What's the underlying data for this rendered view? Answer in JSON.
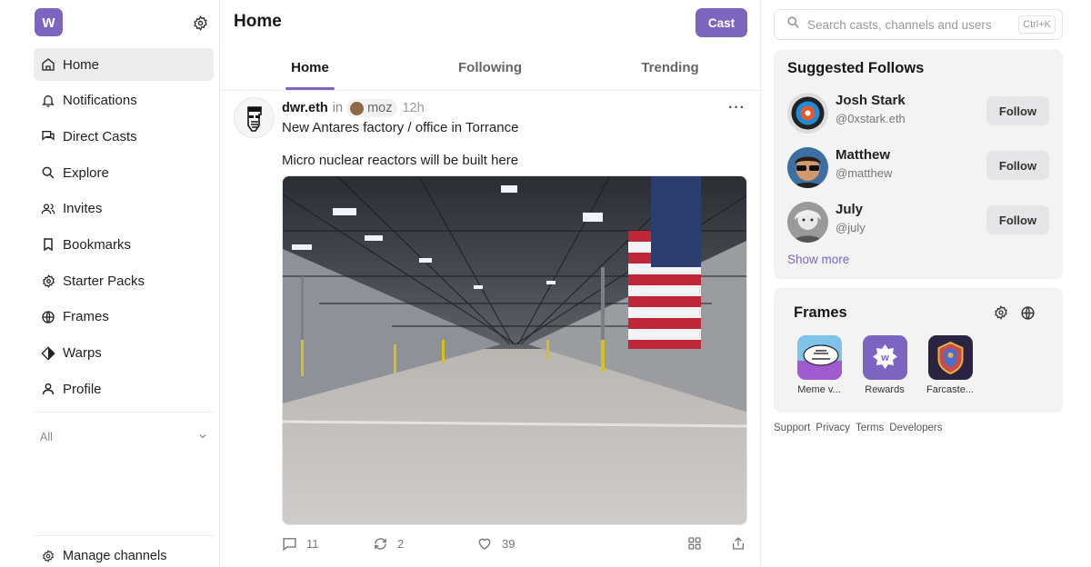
{
  "sidebar": {
    "logo_letter": "w",
    "items": [
      {
        "label": "Home",
        "icon": "home-icon"
      },
      {
        "label": "Notifications",
        "icon": "bell-icon"
      },
      {
        "label": "Direct Casts",
        "icon": "chat-icon"
      },
      {
        "label": "Explore",
        "icon": "search-icon"
      },
      {
        "label": "Invites",
        "icon": "users-icon"
      },
      {
        "label": "Bookmarks",
        "icon": "bookmark-icon"
      },
      {
        "label": "Starter Packs",
        "icon": "package-icon"
      },
      {
        "label": "Frames",
        "icon": "globe-icon"
      },
      {
        "label": "Warps",
        "icon": "diamond-icon"
      },
      {
        "label": "Profile",
        "icon": "person-icon"
      }
    ],
    "filter_label": "All",
    "manage_label": "Manage channels"
  },
  "header": {
    "title": "Home",
    "cast_label": "Cast"
  },
  "tabs": [
    "Home",
    "Following",
    "Trending"
  ],
  "post": {
    "author": "dwr.eth",
    "in_label": "in",
    "channel": "moz",
    "time": "12h",
    "more": "···",
    "line1": "New Antares factory / office in Torrance",
    "line2": "Micro nuclear reactors will be built here",
    "replies": "11",
    "recasts": "2",
    "likes": "39"
  },
  "search": {
    "placeholder": "Search casts, channels and users",
    "shortcut": "Ctrl+K"
  },
  "suggested": {
    "title": "Suggested Follows",
    "users": [
      {
        "name": "Josh Stark",
        "handle": "@0xstark.eth"
      },
      {
        "name": "Matthew",
        "handle": "@matthew"
      },
      {
        "name": "July",
        "handle": "@july"
      }
    ],
    "follow_label": "Follow",
    "show_more": "Show more"
  },
  "frames": {
    "title": "Frames",
    "items": [
      "Meme v...",
      "Rewards",
      "Farcaste..."
    ]
  },
  "footer": [
    "Support",
    "Privacy",
    "Terms",
    "Developers"
  ],
  "colors": {
    "accent": "#7c65c1",
    "panel": "#f3f3f4"
  }
}
